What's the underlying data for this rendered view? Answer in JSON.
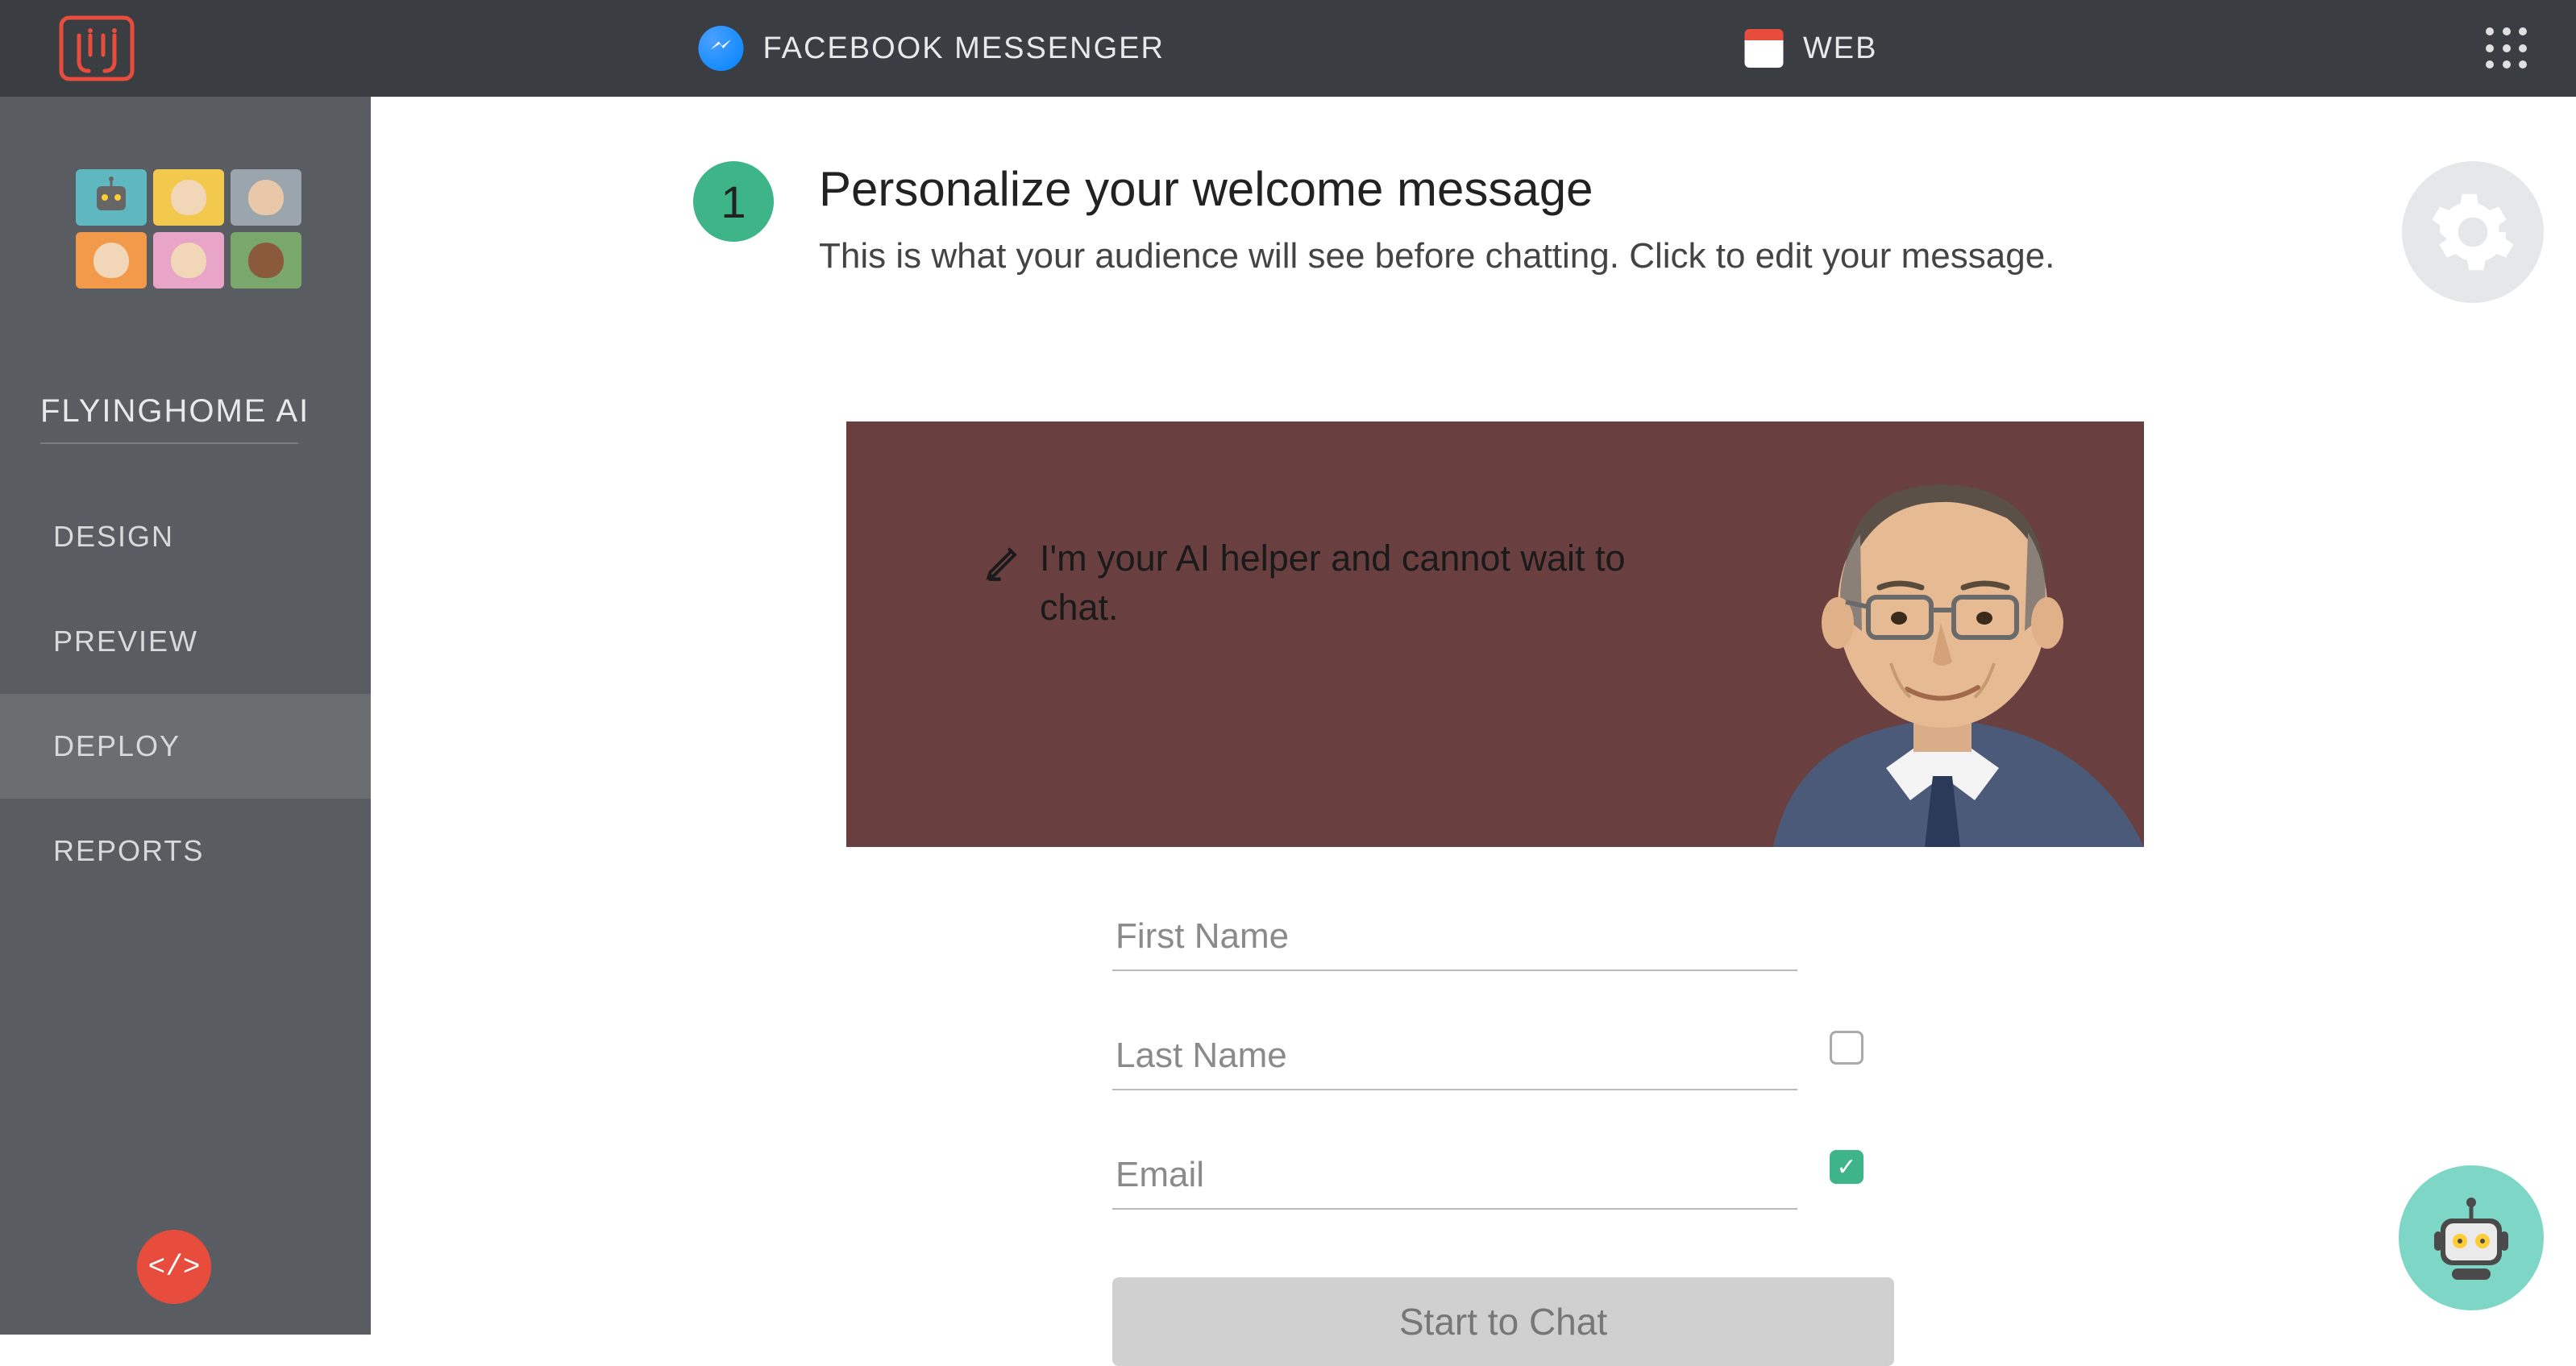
{
  "topbar": {
    "tabs": {
      "facebook": "FACEBOOK MESSENGER",
      "web": "WEB"
    }
  },
  "sidebar": {
    "project_title": "FLYINGHOME AI",
    "items": {
      "design": "DESIGN",
      "preview": "PREVIEW",
      "deploy": "DEPLOY",
      "reports": "REPORTS"
    }
  },
  "step": {
    "number": "1",
    "title": "Personalize your welcome message",
    "subtitle": "This is what your audience will see before chatting. Click to edit your message."
  },
  "banner": {
    "message": "I'm your AI helper and cannot wait to chat."
  },
  "form": {
    "first_name_placeholder": "First Name",
    "last_name_placeholder": "Last Name",
    "email_placeholder": "Email",
    "start_button": "Start to Chat",
    "email_check": "✓"
  },
  "icons": {
    "code_fab": "</>"
  },
  "colors": {
    "accent_green": "#3eb489",
    "accent_red": "#e74c3c",
    "banner_bg": "#6a3f3f",
    "topbar_bg": "#3a3e42",
    "sidebar_bg": "#595d61"
  }
}
